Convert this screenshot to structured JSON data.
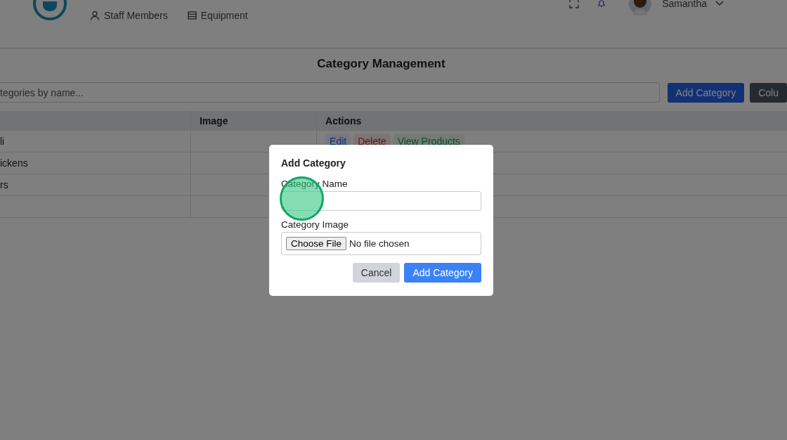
{
  "nav": {
    "items": [
      {
        "label": "Staff Members",
        "kind": "person"
      },
      {
        "label": "Equipment",
        "kind": "list"
      }
    ],
    "user": {
      "name": "Samantha"
    }
  },
  "page": {
    "title": "Category Management",
    "search": {
      "placeholder": "tegories by name..."
    },
    "buttons": [
      {
        "label": "Add Category",
        "kind": "primary"
      },
      {
        "label": "Colu",
        "kind": "dark"
      }
    ]
  },
  "table": {
    "columns": [
      "Image",
      "Actions"
    ],
    "rows": [
      {
        "name": "li",
        "actions": [
          {
            "label": "Edit",
            "kind": "edit"
          },
          {
            "label": "Delete",
            "kind": "delete"
          },
          {
            "label": "View Products",
            "kind": "view"
          }
        ]
      },
      {
        "name": "ickens"
      },
      {
        "name": "rs"
      },
      {
        "name": ""
      }
    ]
  },
  "modal": {
    "title": "Add Category",
    "fields": [
      {
        "label": "Category Name",
        "kind": "text"
      },
      {
        "label": "Category Image",
        "kind": "file",
        "button": "Choose File",
        "value": "No file chosen"
      }
    ],
    "buttons": [
      {
        "label": "Cancel",
        "kind": "secondary"
      },
      {
        "label": "Add Category",
        "kind": "primary"
      }
    ]
  }
}
